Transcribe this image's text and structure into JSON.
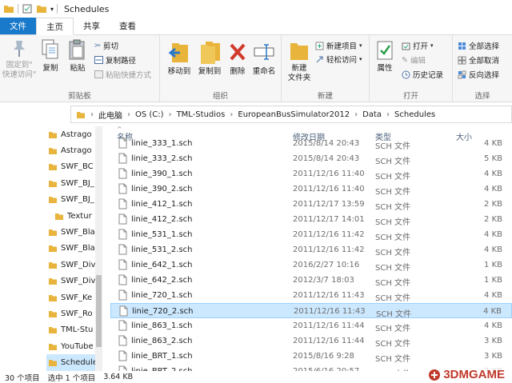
{
  "window": {
    "title": "Schedules"
  },
  "tabs": [
    "文件",
    "主页",
    "共享",
    "查看"
  ],
  "ribbon": {
    "clipboard": {
      "label": "剪贴板",
      "pin": "固定到\"\n快速访问\"",
      "copy": "复制",
      "paste": "粘贴",
      "cut": "剪切",
      "copy_path": "复制路径",
      "paste_shortcut": "粘贴快捷方式"
    },
    "organize": {
      "label": "组织",
      "move_to": "移动到",
      "copy_to": "复制到",
      "delete": "删除",
      "rename": "重命名"
    },
    "new": {
      "label": "新建",
      "new_folder": "新建\n文件夹",
      "new_item": "新建项目",
      "easy_access": "轻松访问"
    },
    "open": {
      "label": "打开",
      "properties": "属性",
      "open": "打开",
      "edit": "编辑",
      "history": "历史记录"
    },
    "select": {
      "label": "选择",
      "select_all": "全部选择",
      "select_none": "全部取消",
      "invert": "反向选择"
    }
  },
  "address": {
    "crumbs": [
      "此电脑",
      "OS (C:)",
      "TML-Studios",
      "EuropeanBusSimulator2012",
      "Data",
      "Schedules"
    ]
  },
  "nav": {
    "items": [
      "Astrago",
      "Astrago",
      "SWF_BC",
      "SWF_BJ_",
      "SWF_BJ_",
      "Textur",
      "SWF_Bla",
      "SWF_Bla",
      "SWF_Div",
      "SWF_Div",
      "SWF_Ke",
      "SWF_Ro",
      "TML-Stu",
      "YouTube",
      "Schedules"
    ]
  },
  "columns": {
    "name": "名称",
    "date": "修改日期",
    "type": "类型",
    "size": "大小"
  },
  "files": [
    {
      "name": "linie_333_2.sch",
      "date": "2015/8/14 20:43",
      "type": "SCH 文件",
      "size": "5 KB"
    },
    {
      "name": "linie_390_1.sch",
      "date": "2011/12/16 11:40",
      "type": "SCH 文件",
      "size": "4 KB"
    },
    {
      "name": "linie_390_2.sch",
      "date": "2011/12/16 11:40",
      "type": "SCH 文件",
      "size": "4 KB"
    },
    {
      "name": "linie_412_1.sch",
      "date": "2011/12/17 13:59",
      "type": "SCH 文件",
      "size": "2 KB"
    },
    {
      "name": "linie_412_2.sch",
      "date": "2011/12/17 14:01",
      "type": "SCH 文件",
      "size": "2 KB"
    },
    {
      "name": "linie_531_1.sch",
      "date": "2011/12/16 11:42",
      "type": "SCH 文件",
      "size": "4 KB"
    },
    {
      "name": "linie_531_2.sch",
      "date": "2011/12/16 11:42",
      "type": "SCH 文件",
      "size": "4 KB"
    },
    {
      "name": "linie_642_1.sch",
      "date": "2016/2/27 10:16",
      "type": "SCH 文件",
      "size": "1 KB"
    },
    {
      "name": "linie_642_2.sch",
      "date": "2012/3/7 18:03",
      "type": "SCH 文件",
      "size": "1 KB"
    },
    {
      "name": "linie_720_1.sch",
      "date": "2011/12/16 11:43",
      "type": "SCH 文件",
      "size": "4 KB"
    },
    {
      "name": "linie_720_2.sch",
      "date": "2011/12/16 11:43",
      "type": "SCH 文件",
      "size": "4 KB"
    },
    {
      "name": "linie_863_1.sch",
      "date": "2011/12/16 11:44",
      "type": "SCH 文件",
      "size": "4 KB"
    },
    {
      "name": "linie_863_2.sch",
      "date": "2011/12/16 11:44",
      "type": "SCH 文件",
      "size": "3 KB"
    },
    {
      "name": "linie_BRT_1.sch",
      "date": "2015/8/16 9:28",
      "type": "SCH 文件",
      "size": "3 KB"
    },
    {
      "name": "linie_BRT_2.sch",
      "date": "2015/6/16 20:57",
      "type": "SCH 文件",
      "size": "3 KB"
    }
  ],
  "partial_row": {
    "name": "linie_333_1.sch",
    "date": "2015/8/14 20:43",
    "type": "SCH 文件",
    "size": "4 KB"
  },
  "selected_index": 10,
  "status": {
    "count": "30 个项目",
    "selected": "选中 1 个项目",
    "size": "3.64 KB"
  },
  "watermark": "3DMGAME",
  "colors": {
    "file_tab": "#1979ca",
    "selection": "#cce8ff",
    "folder": "#e8b43c",
    "delete_red": "#d23a2e"
  }
}
